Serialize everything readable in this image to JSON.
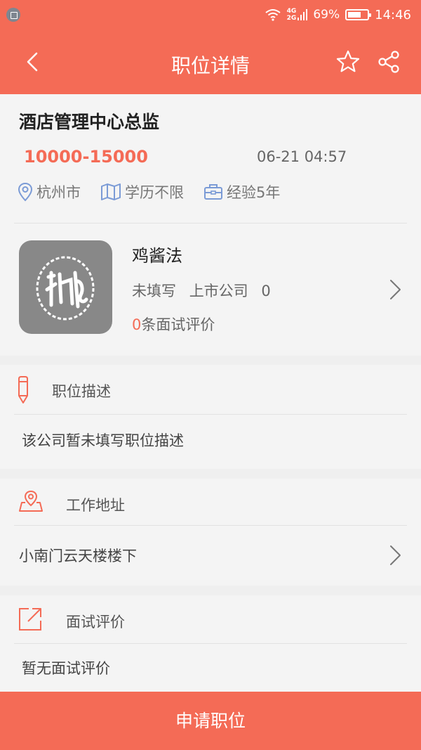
{
  "status_bar": {
    "network_4g": "4G",
    "network_2g": "2G",
    "battery_percent": "69%",
    "time": "14:46"
  },
  "header": {
    "title": "职位详情"
  },
  "job": {
    "title": "酒店管理中心总监",
    "salary": "10000-15000",
    "posted": "06-21 04:57",
    "tags": {
      "city": "杭州市",
      "education": "学历不限",
      "experience": "经验5年"
    }
  },
  "company": {
    "name": "鸡酱法",
    "meta": [
      "未填写",
      "上市公司",
      "0"
    ],
    "review_count": "0",
    "review_suffix": "条面试评价"
  },
  "sections": {
    "description": {
      "title": "职位描述",
      "body": "该公司暂未填写职位描述"
    },
    "address": {
      "title": "工作地址",
      "body": "小南门云天楼楼下"
    },
    "interview": {
      "title": "面试评价",
      "body": "暂无面试评价"
    }
  },
  "apply_button": "申请职位",
  "colors": {
    "accent": "#f46b56",
    "background": "#efefef",
    "card": "#f4f4f4"
  }
}
